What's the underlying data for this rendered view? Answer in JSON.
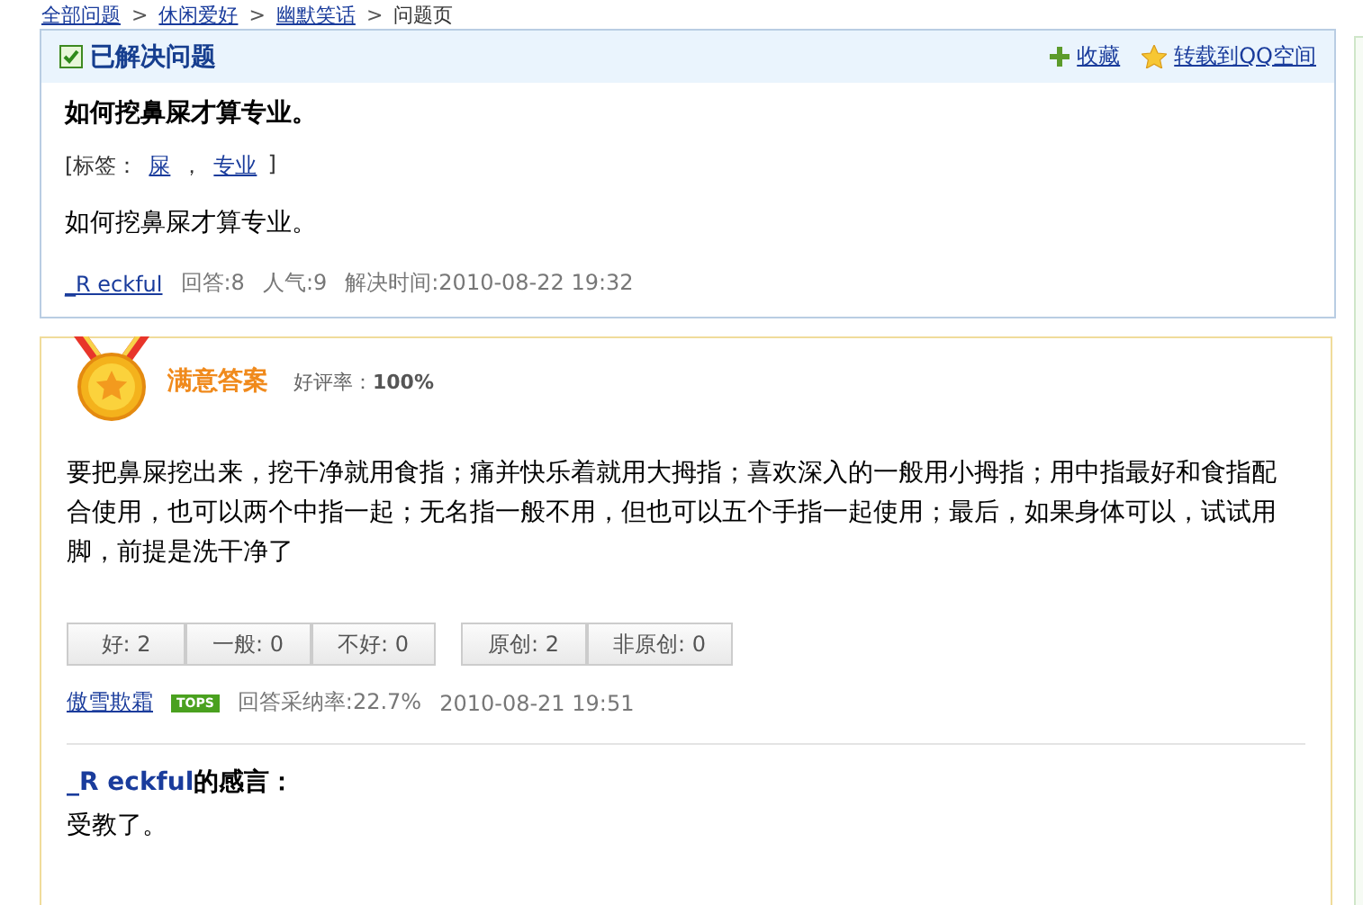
{
  "breadcrumb": [
    {
      "kind": "link",
      "label": "全部问题"
    },
    {
      "kind": "separator",
      "label": ">"
    },
    {
      "kind": "link",
      "label": "休闲爱好"
    },
    {
      "kind": "separator",
      "label": ">"
    },
    {
      "kind": "link",
      "label": "幽默笑话"
    },
    {
      "kind": "separator",
      "label": ">"
    },
    {
      "kind": "current",
      "label": "问题页"
    }
  ],
  "question": {
    "status": "已解决问题",
    "actions": [
      {
        "kind": "add",
        "label": "收藏"
      },
      {
        "kind": "star",
        "label": "转载到QQ空间"
      }
    ],
    "title": "如何挖鼻屎才算专业。",
    "tags_open": "[标签：",
    "tags": [
      {
        "kind": "link",
        "label": "屎"
      },
      {
        "kind": "text",
        "label": "，"
      },
      {
        "kind": "link",
        "label": "专业"
      }
    ],
    "tags_close": "]",
    "body": "如何挖鼻屎才算专业。",
    "author": "_R eckful",
    "answers": "回答:8",
    "popularity": "人气:9",
    "solved_time": "解决时间:2010-08-22 19:32"
  },
  "answer": {
    "heading": "满意答案",
    "rating_label": "好评率：",
    "rating": "100%",
    "body": "要把鼻屎挖出来，挖干净就用食指；痛并快乐着就用大拇指；喜欢深入的一般用小拇指；用中指最好和食指配合使用，也可以两个中指一起；无名指一般不用，但也可以五个手指一起使用；最后，如果身体可以，试试用脚，前提是洗干净了",
    "votes": [
      [
        {
          "label": "好: 2"
        },
        {
          "label": "一般: 0"
        },
        {
          "label": "不好: 0"
        }
      ],
      [
        {
          "label": "原创: 2"
        },
        {
          "label": "非原创: 0"
        }
      ]
    ],
    "author": "傲雪欺霜",
    "badge": "TOPS",
    "adoption": "回答采纳率:22.7%",
    "time": "2010-08-21 19:51"
  },
  "comment": {
    "author": "_R eckful",
    "suffix": "的感言：",
    "text": "受教了。"
  }
}
